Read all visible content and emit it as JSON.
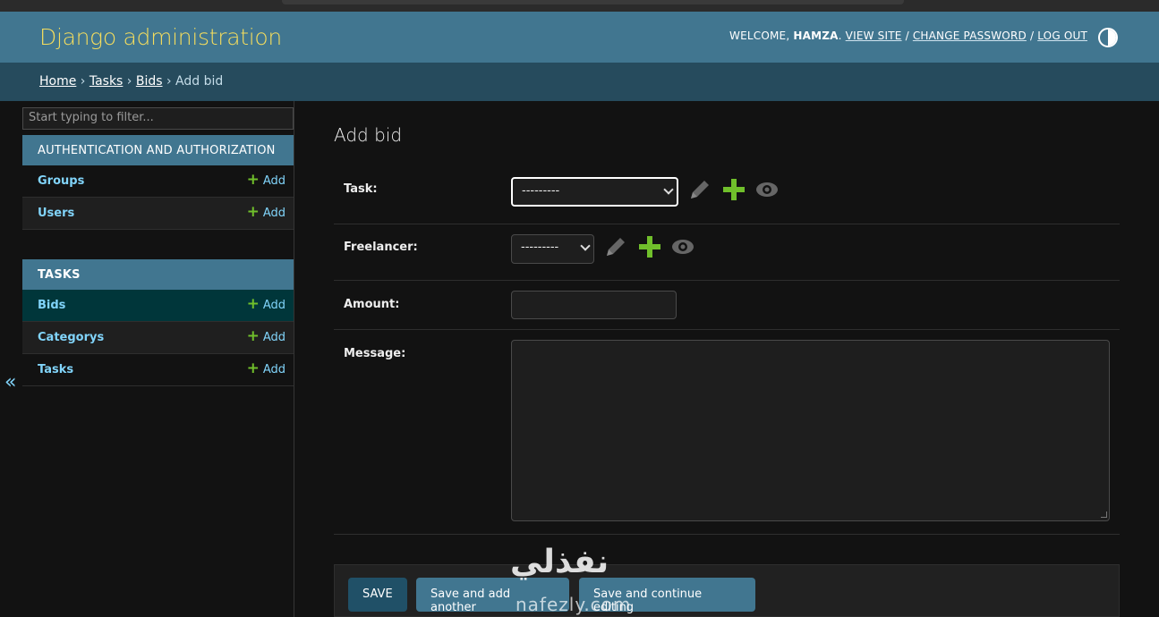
{
  "header": {
    "branding": "Django administration",
    "welcome": "Welcome,",
    "username": "hamza",
    "links": [
      "View site",
      "Change password",
      "Log out"
    ]
  },
  "breadcrumbs": {
    "items": [
      "Home",
      "Tasks",
      "Bids"
    ],
    "current": "Add bid"
  },
  "sidebar": {
    "filter_placeholder": "Start typing to filter...",
    "add_label": "Add",
    "collapse_glyph": "«",
    "modules": [
      {
        "caption": "Authentication and Authorization",
        "models": [
          "Groups",
          "Users"
        ]
      },
      {
        "caption": "Tasks",
        "models": [
          "Bids",
          "Categorys",
          "Tasks"
        ]
      }
    ],
    "current_model": "Bids"
  },
  "content": {
    "title": "Add bid",
    "fields": {
      "task": {
        "label": "Task:",
        "value": "---------"
      },
      "freelancer": {
        "label": "Freelancer:",
        "value": "---------"
      },
      "amount": {
        "label": "Amount:",
        "value": ""
      },
      "message": {
        "label": "Message:",
        "value": ""
      }
    },
    "buttons": {
      "save": "SAVE",
      "save_add_another": "Save and add another",
      "save_continue": "Save and continue editing"
    }
  },
  "watermark": {
    "arabic": "نفذلي",
    "latin": "nafezly.com"
  },
  "colors": {
    "header_bg": "#417690",
    "branding": "#f5dd5d",
    "breadcrumbs_bg": "#264b5d",
    "link": "#81d4fa",
    "add_plus": "#70bf2b",
    "body_bg": "#121212"
  },
  "icons": {
    "theme": "theme-toggle-icon",
    "change": "pencil-icon",
    "add": "plus-icon",
    "view": "eye-icon"
  }
}
